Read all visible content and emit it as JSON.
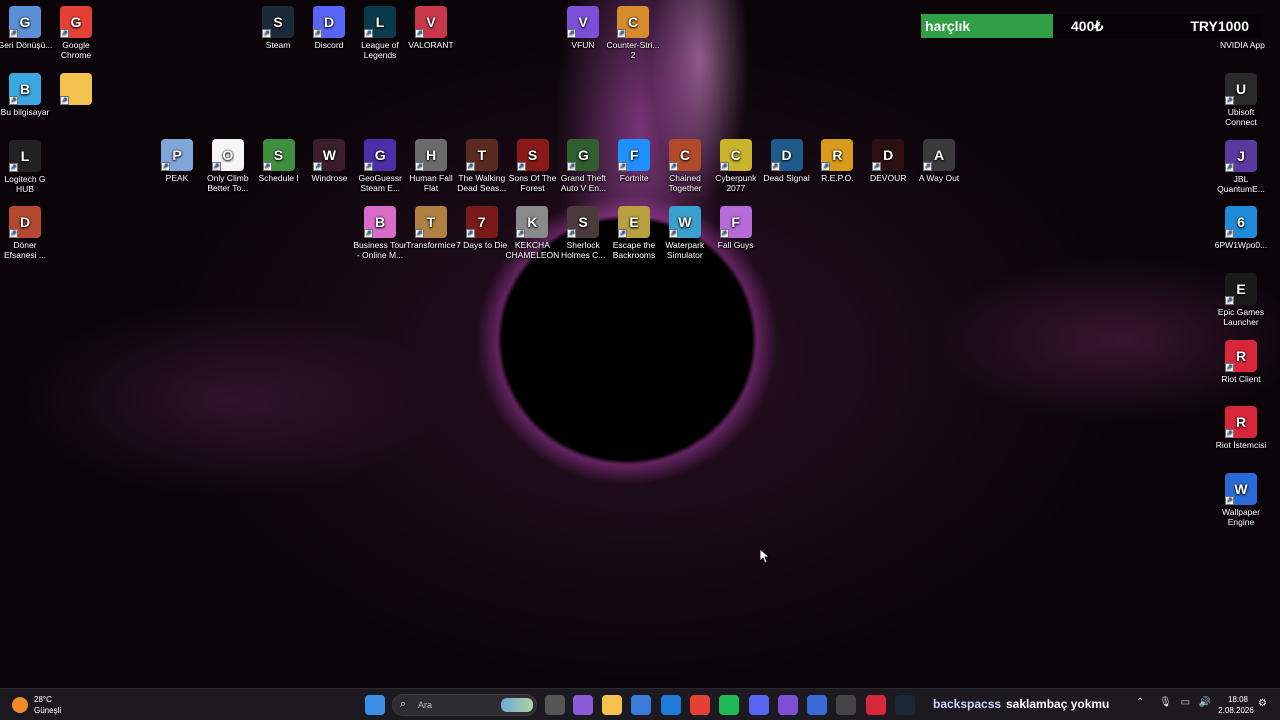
{
  "desktop": {
    "left_column": [
      {
        "label": "Geri Dönüşü...",
        "icon": "recycle-bin-icon",
        "color": "#5b8fd6"
      },
      {
        "label": "Google Chrome",
        "icon": "chrome-icon",
        "color": "#e44134"
      },
      {
        "label": "Bu bilgisayar",
        "icon": "computer-icon",
        "color": "#3aa7e0"
      },
      {
        "label": "",
        "icon": "folder-icon",
        "color": "#f2c14e"
      },
      {
        "label": "Logitech G HUB",
        "icon": "logitech-icon",
        "color": "#222222"
      },
      {
        "label": "Döner Efsanesi ...",
        "icon": "doner-game-icon",
        "color": "#b3472f"
      }
    ],
    "top_row": [
      {
        "label": "Steam",
        "icon": "steam-icon",
        "color": "#1b2838"
      },
      {
        "label": "Discord",
        "icon": "discord-icon",
        "color": "#5865f2"
      },
      {
        "label": "League of Legends",
        "icon": "league-icon",
        "color": "#0a3b4a"
      },
      {
        "label": "VALORANT",
        "icon": "valorant-icon",
        "color": "#c8374a"
      },
      {
        "label": "VFUN",
        "icon": "vfun-icon",
        "color": "#7d4fd6"
      },
      {
        "label": "Counter-Stri... 2",
        "icon": "counter-strike-icon",
        "color": "#d88b2c"
      }
    ],
    "games_row1": [
      {
        "label": "PEAK",
        "icon": "peak-icon",
        "color": "#7fa6d8"
      },
      {
        "label": "Only Climb Better To...",
        "icon": "file-icon",
        "color": "#f5f5f5"
      },
      {
        "label": "Schedule I",
        "icon": "schedule-icon",
        "color": "#3f8f3f"
      },
      {
        "label": "Windrose",
        "icon": "windrose-icon",
        "color": "#3a1e2a"
      },
      {
        "label": "GeoGuessr Steam E...",
        "icon": "geoguessr-icon",
        "color": "#4b2fa8"
      },
      {
        "label": "Human Fall Flat",
        "icon": "human-fall-flat-icon",
        "color": "#6b6b6b"
      },
      {
        "label": "The Walking Dead Seas...",
        "icon": "walking-dead-icon",
        "color": "#5a2a20"
      },
      {
        "label": "Sons Of The Forest",
        "icon": "sons-forest-icon",
        "color": "#8a1a1a"
      },
      {
        "label": "Grand Theft Auto V En...",
        "icon": "gta-icon",
        "color": "#2f5e2f"
      },
      {
        "label": "Fortnite",
        "icon": "fortnite-icon",
        "color": "#1e90ff"
      },
      {
        "label": "Chained Together",
        "icon": "chained-icon",
        "color": "#b24a2a"
      },
      {
        "label": "Cyberpunk 2077",
        "icon": "cyberpunk-icon",
        "color": "#c8b32a"
      },
      {
        "label": "Dead Signal",
        "icon": "dead-signal-icon",
        "color": "#1e5a8a"
      },
      {
        "label": "R.E.P.O.",
        "icon": "repo-icon",
        "color": "#d89a1a"
      },
      {
        "label": "DEVOUR",
        "icon": "devour-icon",
        "color": "#2a1010"
      },
      {
        "label": "A Way Out",
        "icon": "a-way-out-icon",
        "color": "#3a3a3a"
      }
    ],
    "games_row2": [
      {
        "label": "Business Tour - Online M...",
        "icon": "business-tour-icon",
        "color": "#d86ac8"
      },
      {
        "label": "Transformice",
        "icon": "transformice-icon",
        "color": "#b08040"
      },
      {
        "label": "7 Days to Die",
        "icon": "seven-days-icon",
        "color": "#7a1a1a"
      },
      {
        "label": "KEKCHA CHAMELEON",
        "icon": "chameleon-icon",
        "color": "#8a8a8a"
      },
      {
        "label": "Sherlock Holmes C...",
        "icon": "sherlock-icon",
        "color": "#4a3a3a"
      },
      {
        "label": "Escape the Backrooms",
        "icon": "backrooms-icon",
        "color": "#b8a040"
      },
      {
        "label": "Waterpark Simulator",
        "icon": "waterpark-icon",
        "color": "#3aa0d0"
      },
      {
        "label": "Fall Guys",
        "icon": "fall-guys-icon",
        "color": "#b86ad8"
      }
    ],
    "right_column": [
      {
        "label": "Ubisoft Connect",
        "icon": "ubisoft-icon",
        "color": "#2a2a2a"
      },
      {
        "label": "JBL QuantumE...",
        "icon": "jbl-icon",
        "color": "#5a3aa0"
      },
      {
        "label": "6PW1Wpo0...",
        "icon": "edge-icon",
        "color": "#1f8ad8"
      },
      {
        "label": "Epic Games Launcher",
        "icon": "epic-games-icon",
        "color": "#1a1a1a"
      },
      {
        "label": "Riot Client",
        "icon": "riot-client-icon",
        "color": "#d8263a"
      },
      {
        "label": "Riot İstemcisi",
        "icon": "riot-istemcisi-icon",
        "color": "#d8263a"
      },
      {
        "label": "Wallpaper Engine",
        "icon": "wallpaper-engine-icon",
        "color": "#2a6ad8"
      }
    ]
  },
  "widget": {
    "name": "harçlık",
    "current": "400₺",
    "goal": "TRY1000",
    "progress": 0.4,
    "app": "NVIDIA App"
  },
  "taskbar": {
    "weather_temp": "28°C",
    "weather_desc": "Güneşli",
    "search_placeholder": "Ara",
    "marquee_1": "backspacss",
    "marquee_2": "saklambaç yokmu",
    "tray_chevron": "⌃",
    "time": "18:08",
    "date": "2.08.2026",
    "pinned": [
      {
        "icon": "start-icon",
        "color": "#3a8ee6"
      },
      {
        "icon": "task-view-icon",
        "color": "#555555"
      },
      {
        "icon": "copilot-icon",
        "color": "#8a5ad8"
      },
      {
        "icon": "file-explorer-icon",
        "color": "#f2c14e"
      },
      {
        "icon": "store-icon",
        "color": "#3a7ad8"
      },
      {
        "icon": "outlook-icon",
        "color": "#1e7ad8"
      },
      {
        "icon": "chrome-icon",
        "color": "#e44134"
      },
      {
        "icon": "spotify-icon",
        "color": "#1db954"
      },
      {
        "icon": "discord-icon",
        "color": "#5865f2"
      },
      {
        "icon": "vfun-icon",
        "color": "#7d4fd6"
      },
      {
        "icon": "launcher-icon",
        "color": "#3a6ad8"
      },
      {
        "icon": "obs-icon",
        "color": "#444444"
      },
      {
        "icon": "riot-client-icon",
        "color": "#d8263a"
      },
      {
        "icon": "steam-icon",
        "color": "#1b2838"
      }
    ]
  }
}
